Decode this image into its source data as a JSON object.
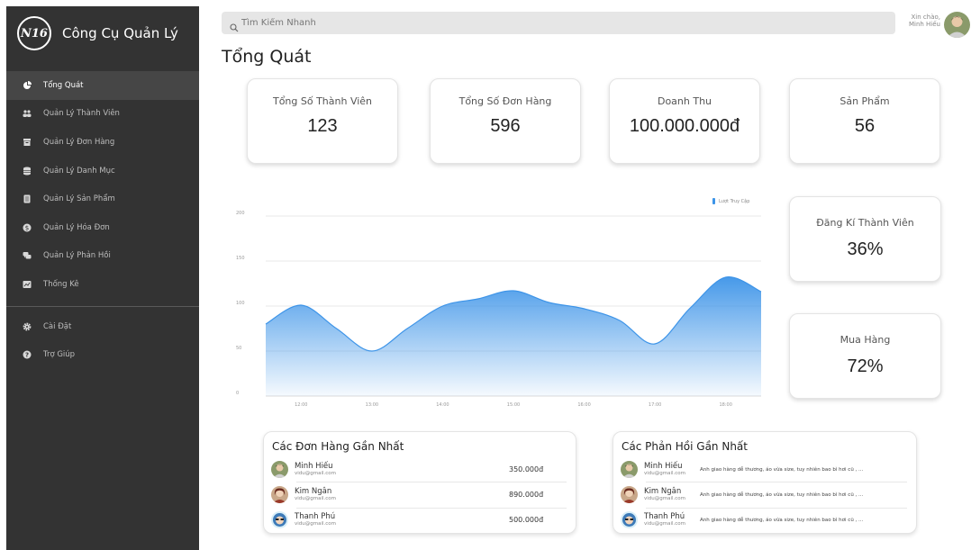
{
  "brand": {
    "logo": "N16",
    "title": "Công Cụ Quản Lý"
  },
  "sidebar": {
    "items": [
      {
        "label": "Tổng Quát",
        "icon": "pie-chart-icon",
        "active": true
      },
      {
        "label": "Quản Lý Thành Viên",
        "icon": "users-icon"
      },
      {
        "label": "Quản Lý Đơn Hàng",
        "icon": "order-box-icon"
      },
      {
        "label": "Quản Lý Danh Mục",
        "icon": "database-icon"
      },
      {
        "label": "Quản Lý Sản Phẩm",
        "icon": "product-list-icon"
      },
      {
        "label": "Quản Lý Hóa Đơn",
        "icon": "dollar-circle-icon"
      },
      {
        "label": "Quản Lý Phản Hồi",
        "icon": "chat-icon"
      },
      {
        "label": "Thống Kê",
        "icon": "report-icon"
      }
    ],
    "bottom_items": [
      {
        "label": "Cài Đặt",
        "icon": "gear-icon"
      },
      {
        "label": "Trợ Giúp",
        "icon": "help-icon"
      }
    ]
  },
  "search": {
    "placeholder": "Tìm Kiếm Nhanh",
    "value": ""
  },
  "user": {
    "greeting": "Xin chào,",
    "name": "Minh Hiếu"
  },
  "page_title": "Tổng Quát",
  "stats": [
    {
      "label": "Tổng Số Thành Viên",
      "value": "123"
    },
    {
      "label": "Tổng Số Đơn Hàng",
      "value": "596"
    },
    {
      "label": "Doanh Thu",
      "value": "100.000.000đ"
    },
    {
      "label": "Sản Phẩm",
      "value": "56"
    }
  ],
  "side_stats": [
    {
      "label": "Đăng Kí Thành Viên",
      "value": "36%"
    },
    {
      "label": "Mua Hàng",
      "value": "72%"
    }
  ],
  "chart_data": {
    "type": "area",
    "x": [
      "11:30",
      "12:00",
      "12:30",
      "13:00",
      "13:30",
      "14:00",
      "14:30",
      "15:00",
      "15:30",
      "16:00",
      "16:30",
      "17:00",
      "17:30",
      "18:00",
      "18:30"
    ],
    "series": [
      {
        "name": "Lượt Truy Cập",
        "values": [
          80,
          101,
          75,
          50,
          75,
          100,
          108,
          117,
          104,
          97,
          84,
          58,
          98,
          132,
          116
        ]
      }
    ],
    "xticks": [
      "12:00",
      "13:00",
      "14:00",
      "15:00",
      "16:00",
      "17:00",
      "18:00"
    ],
    "yticks": [
      0,
      50,
      100,
      150,
      200
    ],
    "ylim": [
      0,
      200
    ],
    "grid": true,
    "legend_position": "top-right",
    "color": "#3d94e8"
  },
  "recent_orders": {
    "title": "Các Đơn Hàng Gần Nhất",
    "rows": [
      {
        "name": "Minh Hiếu",
        "email": "vidu@gmail.com",
        "amount": "350.000đ"
      },
      {
        "name": "Kim Ngân",
        "email": "vidu@gmail.com",
        "amount": "890.000đ"
      },
      {
        "name": "Thanh Phú",
        "email": "vidu@gmail.com",
        "amount": "500.000đ"
      }
    ]
  },
  "recent_feedback": {
    "title": "Các Phản Hồi Gần Nhất",
    "rows": [
      {
        "name": "Minh Hiếu",
        "email": "vidu@gmail.com",
        "text": "Anh giao hàng dễ thương, áo vừa size, tuy nhiên bao bì hơi cũ , ..."
      },
      {
        "name": "Kim Ngân",
        "email": "vidu@gmail.com",
        "text": "Anh giao hàng dễ thương, áo vừa size, tuy nhiên bao bì hơi cũ , ..."
      },
      {
        "name": "Thanh Phú",
        "email": "vidu@gmail.com",
        "text": "Anh giao hàng dễ thương, áo vừa size, tuy nhiên bao bì hơi cũ , ..."
      }
    ]
  }
}
